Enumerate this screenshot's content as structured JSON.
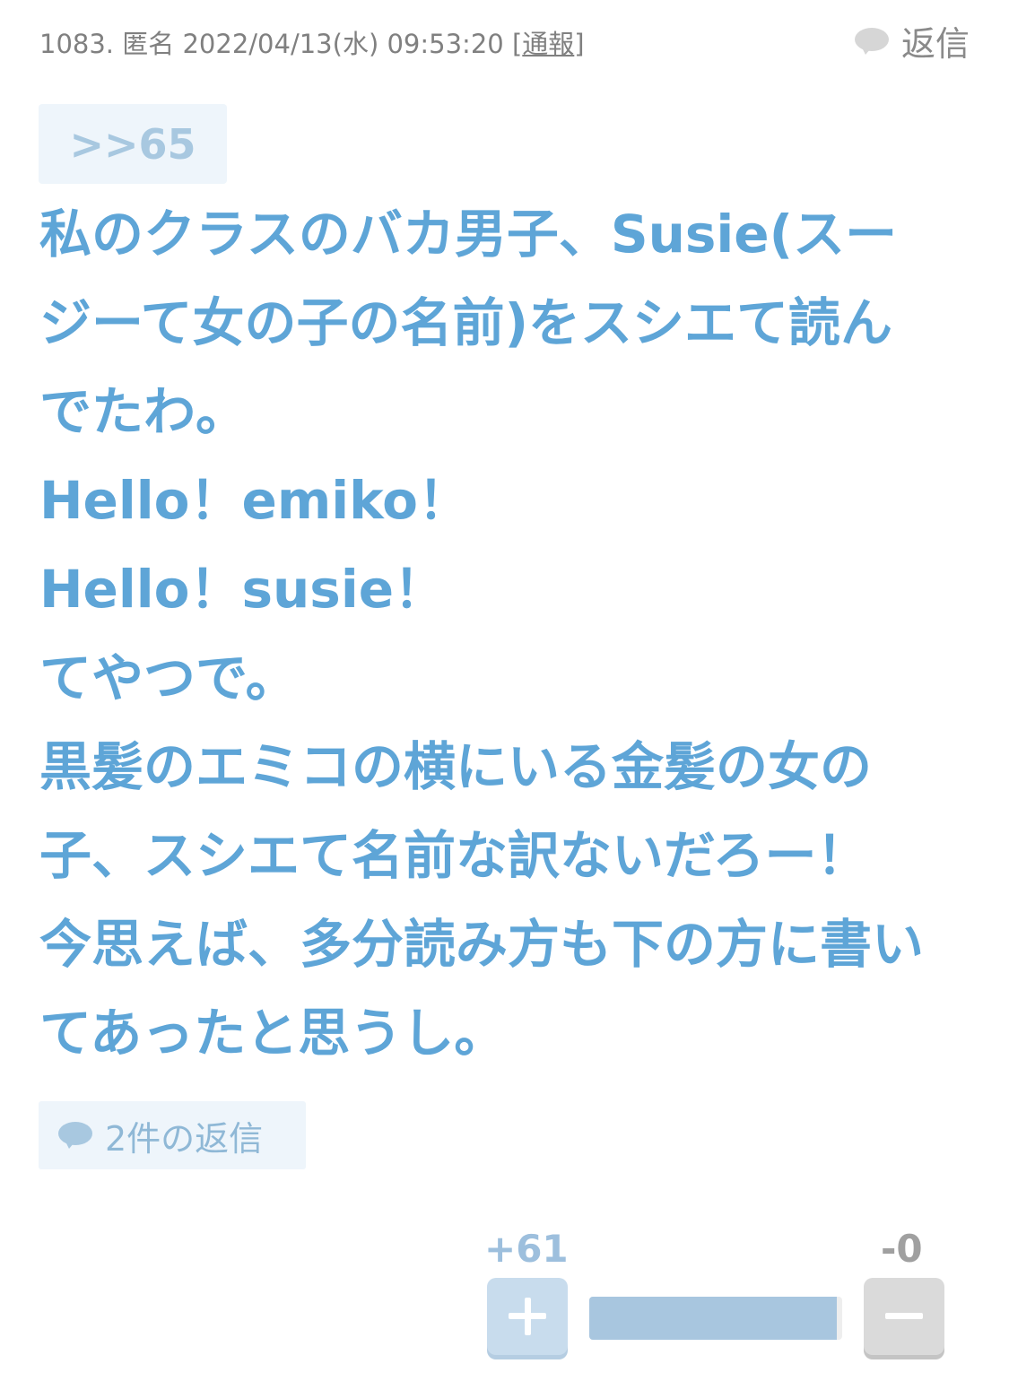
{
  "comment": {
    "meta": {
      "number": "1083.",
      "author": "匿名",
      "datetime": "2022/04/13(水) 09:53:20",
      "report_label": "通報"
    },
    "reply_label": "返信",
    "reply_icon": "speech-bubble-icon",
    "anchor": ">>65",
    "body_lines": [
      "私のクラスのバカ男子、Susie(スー",
      "ジーて女の子の名前)をスシエて読ん",
      "でたわ。",
      "Hello！emiko！",
      "Hello！susie！",
      "てやつで。",
      "黒髪のエミコの横にいる金髪の女の",
      "子、スシエて名前な訳ないだろー！",
      "今思えば、多分読み方も下の方に書い",
      "てあったと思うし。"
    ],
    "replies_button_label": "2件の返信"
  },
  "votes": {
    "plus_label": "+61",
    "minus_label": "-0",
    "plus_count": 61,
    "minus_count": 0,
    "plus_ratio": 1.0
  },
  "colors": {
    "body_text": "#5ea5d7",
    "anchor_bg": "#eef5fb",
    "plus_accent": "#9dbfdd",
    "minus_accent": "#a0a0a0"
  }
}
